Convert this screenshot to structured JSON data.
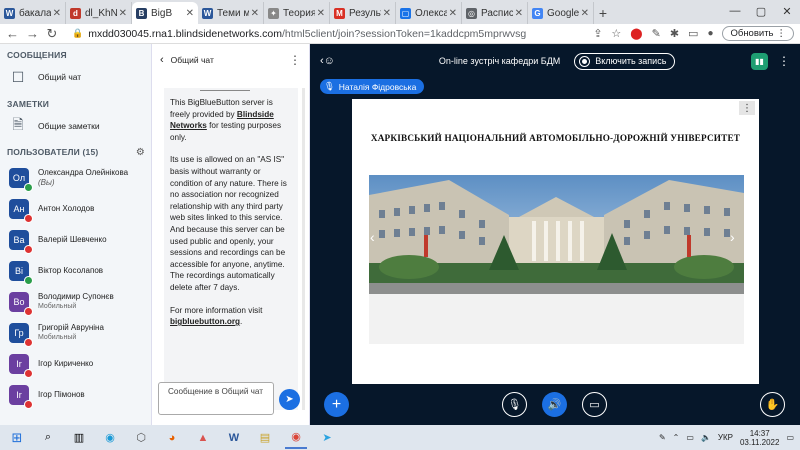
{
  "browser": {
    "tabs": [
      {
        "title": "бакала",
        "color": "#2b579a",
        "glyph": "W"
      },
      {
        "title": "dl_KhNA",
        "color": "#c0392b",
        "glyph": "d"
      },
      {
        "title": "BigB",
        "color": "#273e63",
        "glyph": "B",
        "active": true
      },
      {
        "title": "Теми м",
        "color": "#2b579a",
        "glyph": "W"
      },
      {
        "title": "Теория",
        "color": "#888888",
        "glyph": "✦"
      },
      {
        "title": "Результ",
        "color": "#d93025",
        "glyph": "M"
      },
      {
        "title": "Олексан",
        "color": "#1a73e8",
        "glyph": "▢"
      },
      {
        "title": "Расписа",
        "color": "#5f6368",
        "glyph": "◎"
      },
      {
        "title": "Google",
        "color": "#4285f4",
        "glyph": "G"
      }
    ],
    "url_host": "mxdd030045.rna1.blindsidenetworks.com",
    "url_path": "/html5client/join?sessionToken=1kaddcpm5mprwvsg",
    "renew_label": "Обновить"
  },
  "sidebar": {
    "messages_heading": "СООБЩЕНИЯ",
    "chat_item": "Общий чат",
    "notes_heading": "ЗАМЕТКИ",
    "notes_item": "Общие заметки",
    "users_heading": "ПОЛЬЗОВАТЕЛИ (15)",
    "users": [
      {
        "initials": "Ол",
        "name": "Олександра Олейнікова",
        "suffix": "(Вы)",
        "color": "#1f4e9c",
        "mic": "on"
      },
      {
        "initials": "Ан",
        "name": "Антон Холодов",
        "color": "#1f4e9c",
        "mic": "off"
      },
      {
        "initials": "Ва",
        "name": "Валерій Шевченко",
        "color": "#1f4e9c",
        "mic": "off"
      },
      {
        "initials": "Ві",
        "name": "Віктор Косолапов",
        "color": "#1f4e9c",
        "mic": "on"
      },
      {
        "initials": "Во",
        "name": "Володимир Супонєв",
        "sub": "Мобильный",
        "color": "#6b3fa0",
        "mic": "off"
      },
      {
        "initials": "Гр",
        "name": "Григорій Авруніна",
        "sub": "Мобильный",
        "color": "#1f4e9c",
        "mic": "off"
      },
      {
        "initials": "Ir",
        "name": "Ігор Кириченко",
        "color": "#6b3fa0",
        "mic": "off"
      },
      {
        "initials": "Ir",
        "name": "Ігор Пімонов",
        "color": "#6b3fa0",
        "mic": "off"
      }
    ]
  },
  "chat": {
    "title": "Общий чат",
    "msg1_a": "This BigBlueButton server is freely provided by ",
    "msg1_link": "Blindside Networks",
    "msg1_b": " for testing purposes only.",
    "msg2": "Its use is allowed on an \"AS IS\" basis without warranty or condition of any nature. There is no association nor recognized relationship with any third party web sites linked to this service. And because this server can be used public and openly, your sessions and recordings can be accessible for anyone, anytime. The recordings automatically delete after 7 days.",
    "msg3_a": "For more information visit ",
    "msg3_link": "bigbluebutton.org",
    "msg3_b": ".",
    "input_placeholder": "Сообщение в Общий чат"
  },
  "meeting": {
    "title": "On-line зустріч кафедри БДМ",
    "record_label": "Включить запись",
    "talker": "Наталія Фідровська",
    "slide_title": "ХАРКІВСЬКИЙ НАЦІОНАЛЬНИЙ АВТОМОБІЛЬНО-ДОРОЖНІЙ УНІВЕРСИТЕТ"
  },
  "taskbar": {
    "lang": "УКР",
    "time": "14:37",
    "date": "03.11.2022"
  }
}
